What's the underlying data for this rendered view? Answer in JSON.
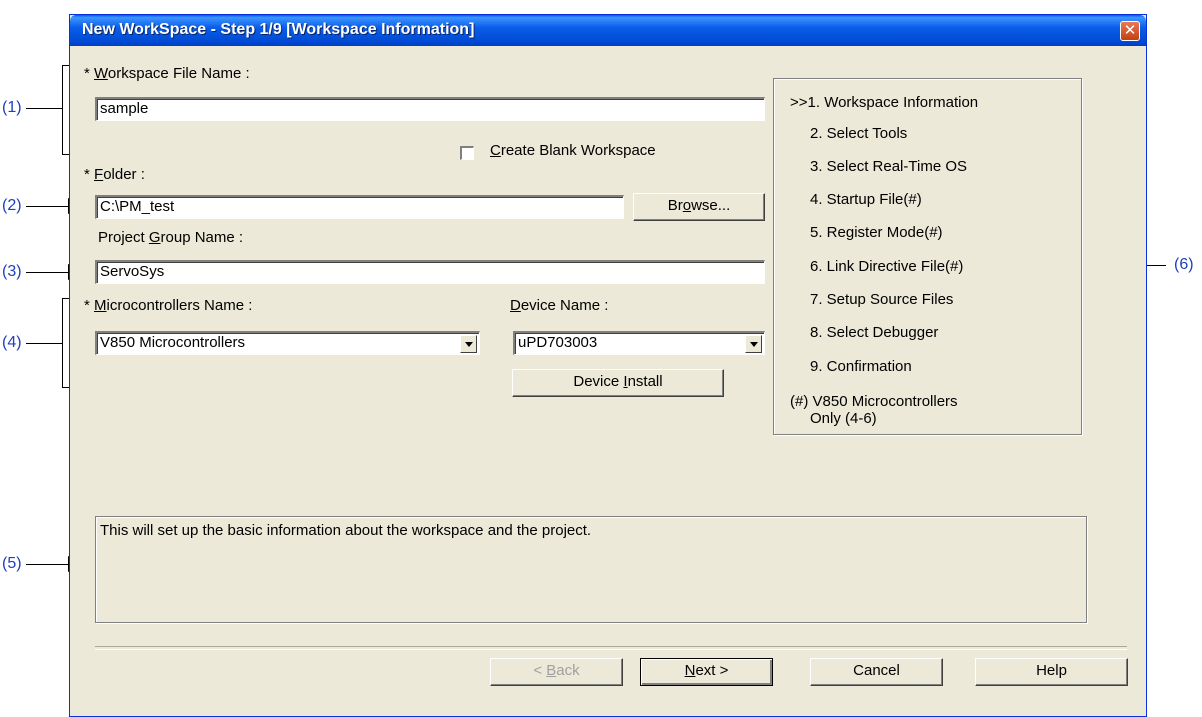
{
  "window": {
    "title": "New WorkSpace - Step 1/9 [Workspace Information]",
    "close_glyph": "✕"
  },
  "form": {
    "workspace_file": {
      "star": "* ",
      "mnemonic": "W",
      "rest": "orkspace File Name :",
      "value": "sample"
    },
    "blank_workspace": {
      "mnemonic": "C",
      "rest": "reate Blank Workspace",
      "checked": false
    },
    "folder": {
      "star": "* ",
      "mnemonic": "F",
      "rest": "older :",
      "value": "C:\\PM_test",
      "browse_pre": "Br",
      "browse_mnemonic": "o",
      "browse_post": "wse..."
    },
    "project_group": {
      "pre": "Project ",
      "mnemonic": "G",
      "rest": "roup Name :",
      "value": "ServoSys"
    },
    "microcontrollers": {
      "star": "* ",
      "mnemonic": "M",
      "rest": "icrocontrollers Name :",
      "value": "V850 Microcontrollers"
    },
    "device": {
      "mnemonic": "D",
      "rest": "evice Name :",
      "value": "uPD703003",
      "install_pre": "Device ",
      "install_mnemonic": "I",
      "install_post": "nstall"
    }
  },
  "steps": [
    ">>1. Workspace Information",
    "2. Select Tools",
    "3. Select Real-Time OS",
    "4. Startup File(#)",
    "5. Register Mode(#)",
    "6. Link Directive File(#)",
    "7. Setup Source Files",
    "8. Select Debugger",
    "9. Confirmation"
  ],
  "steps_note": [
    "(#) V850 Microcontrollers",
    "Only (4-6)"
  ],
  "description": "This will set up the basic information about the workspace and the project.",
  "buttons": {
    "back_pre": "< ",
    "back_mnemonic": "B",
    "back_post": "ack",
    "next_mnemonic": "N",
    "next_post": "ext >",
    "cancel": "Cancel",
    "help": "Help"
  },
  "callouts": [
    "(1)",
    "(2)",
    "(3)",
    "(4)",
    "(5)",
    "(6)"
  ]
}
